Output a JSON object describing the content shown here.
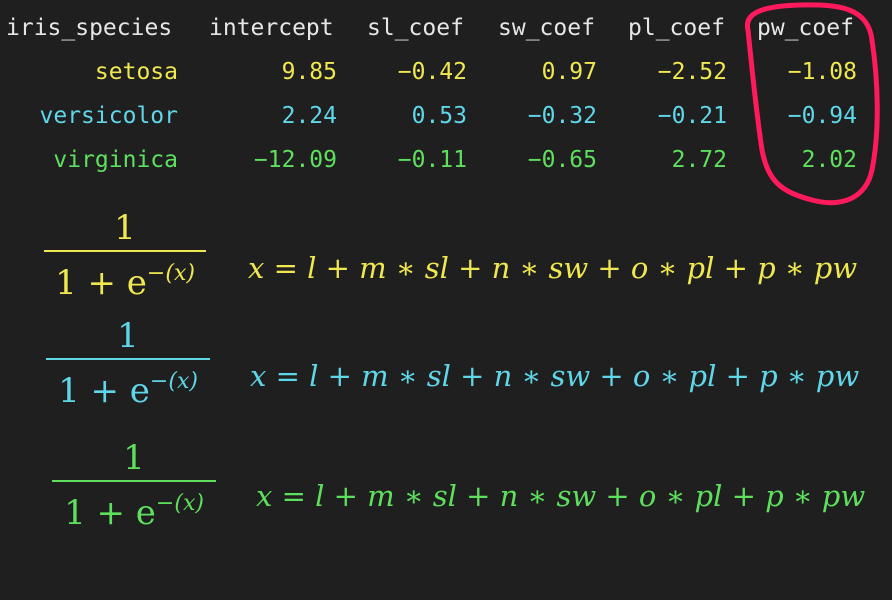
{
  "table": {
    "headers": [
      "iris_species",
      "intercept",
      "sl_coef",
      "sw_coef",
      "pl_coef",
      "pw_coef"
    ],
    "rows": [
      {
        "species": "setosa",
        "intercept": "9.85",
        "sl": "−0.42",
        "sw": "0.97",
        "pl": "−2.52",
        "pw": "−1.08",
        "color": "#f0e850"
      },
      {
        "species": "versicolor",
        "intercept": "2.24",
        "sl": "0.53",
        "sw": "−0.32",
        "pl": "−0.21",
        "pw": "−0.94",
        "color": "#5fd7e8"
      },
      {
        "species": "virginica",
        "intercept": "−12.09",
        "sl": "−0.11",
        "sw": "−0.65",
        "pl": "2.72",
        "pw": "2.02",
        "color": "#5ee05e"
      }
    ],
    "highlight": {
      "column": "pw_coef",
      "color": "#ff1a5c"
    }
  },
  "formulas": [
    {
      "numerator": "1",
      "denominator_base": "1 + e",
      "exponent": "−(x)",
      "equation": "x = l + m ∗ sl + n ∗ sw + o ∗ pl + p ∗ pw",
      "color": "#f0e850"
    },
    {
      "numerator": "1",
      "denominator_base": "1 + e",
      "exponent": "−(x)",
      "equation": "x = l + m ∗ sl + n ∗ sw + o ∗ pl + p ∗ pw",
      "color": "#5fd7e8"
    },
    {
      "numerator": "1",
      "denominator_base": "1 + e",
      "exponent": "−(x)",
      "equation": "x = l + m ∗ sl + n ∗ sw + o ∗ pl + p ∗ pw",
      "color": "#5ee05e"
    }
  ]
}
